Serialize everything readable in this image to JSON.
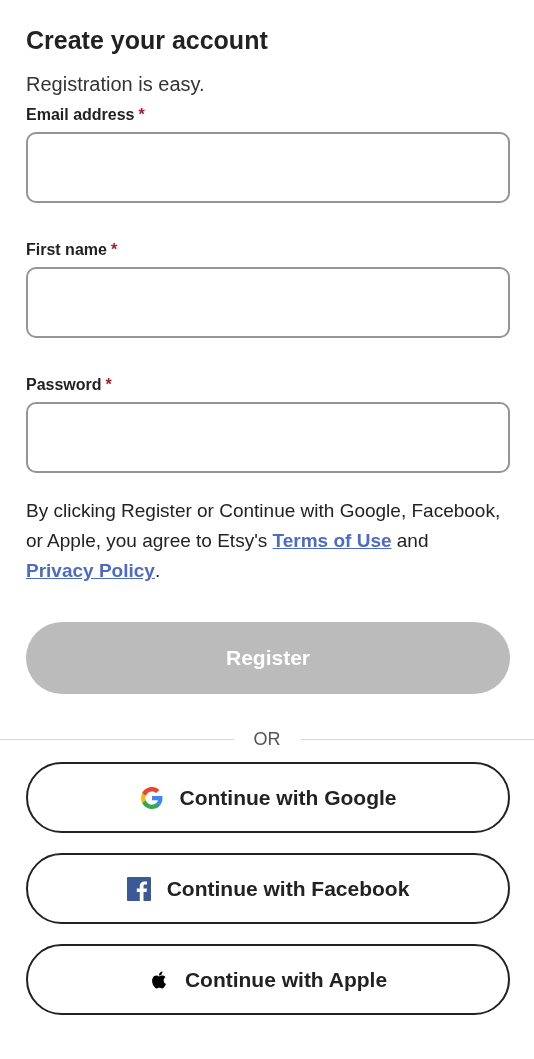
{
  "title": "Create your account",
  "subtitle": "Registration is easy.",
  "fields": [
    {
      "label": "Email address",
      "required_mark": "*"
    },
    {
      "label": "First name",
      "required_mark": "*"
    },
    {
      "label": "Password",
      "required_mark": "*"
    }
  ],
  "disclaimer": [
    {
      "kind": "text",
      "text": "By clicking Register or Continue with Google, Facebook, or Apple, you agree to Etsy's "
    },
    {
      "kind": "link",
      "text": "Terms of Use"
    },
    {
      "kind": "text",
      "text": " and "
    },
    {
      "kind": "link",
      "text": "Privacy Policy"
    },
    {
      "kind": "text",
      "text": "."
    }
  ],
  "register_button": {
    "label": "Register",
    "disabled": true
  },
  "divider_text": "OR",
  "social_buttons": [
    {
      "kind": "google",
      "label": "Continue with Google"
    },
    {
      "kind": "facebook",
      "label": "Continue with Facebook"
    },
    {
      "kind": "apple",
      "label": "Continue with Apple"
    }
  ]
}
